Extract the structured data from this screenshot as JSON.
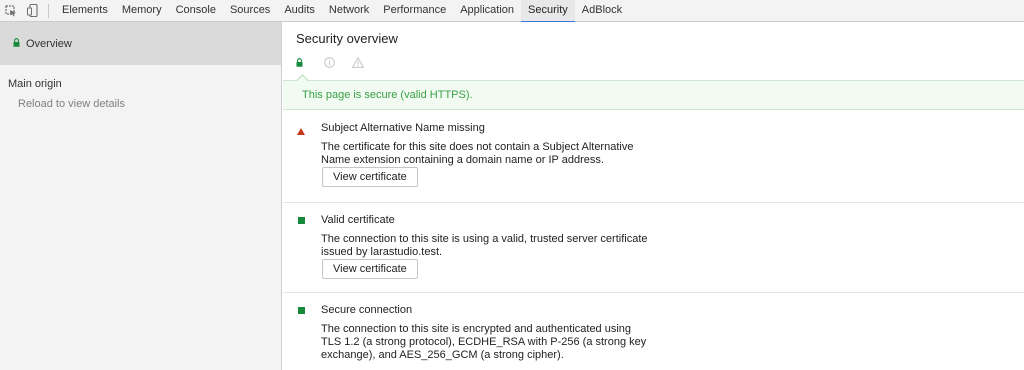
{
  "toolbar": {
    "icons": [
      "inspect-element-icon",
      "device-mode-icon"
    ],
    "tabs": [
      {
        "label": "Elements"
      },
      {
        "label": "Memory"
      },
      {
        "label": "Console"
      },
      {
        "label": "Sources"
      },
      {
        "label": "Audits"
      },
      {
        "label": "Network"
      },
      {
        "label": "Performance"
      },
      {
        "label": "Application"
      },
      {
        "label": "Security",
        "active": true
      },
      {
        "label": "AdBlock"
      }
    ]
  },
  "sidebar": {
    "overview_label": "Overview",
    "main_origin_label": "Main origin",
    "reload_hint": "Reload to view details"
  },
  "main": {
    "title": "Security overview",
    "summary_icons": [
      "lock-icon",
      "info-icon",
      "warning-icon"
    ],
    "banner": "This page is secure (valid HTTPS).",
    "explanations": [
      {
        "severity": "warning",
        "icon": "warning-triangle-icon",
        "title": "Subject Alternative Name missing",
        "description": "The certificate for this site does not contain a Subject Alternative Name extension containing a domain name or IP address.",
        "button": "View certificate"
      },
      {
        "severity": "secure",
        "icon": "secure-square-icon",
        "title": "Valid certificate",
        "description": "The connection to this site is using a valid, trusted server certificate issued by larastudio.test.",
        "button": "View certificate"
      },
      {
        "severity": "secure",
        "icon": "secure-square-icon",
        "title": "Secure connection",
        "description": "The connection to this site is encrypted and authenticated using TLS 1.2 (a strong protocol), ECDHE_RSA with P-256 (a strong key exchange), and AES_256_GCM (a strong cipher)."
      }
    ]
  },
  "colors": {
    "secure_green": "#168a3a",
    "banner_text": "#3aa046",
    "warning_red": "#c5391b",
    "active_tab_underline": "#3879d9"
  }
}
